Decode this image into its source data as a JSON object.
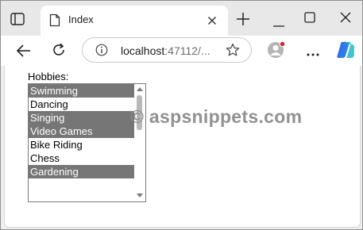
{
  "browser": {
    "tab": {
      "title": "Index",
      "favicon": "page-icon"
    },
    "address": {
      "host": "localhost",
      "rest": ":47112/..."
    },
    "icons": [
      "tab-actions-icon",
      "close-icon",
      "plus-icon",
      "minimize-icon",
      "maximize-icon",
      "close-icon",
      "back-arrow-icon",
      "refresh-icon",
      "info-icon",
      "star-icon",
      "profile-icon",
      "more-icon",
      "copilot-icon"
    ],
    "colors": {
      "tabstrip": "#e8e8e8",
      "notification_dot": "#d8202a"
    }
  },
  "form": {
    "label": "Hobbies:",
    "options": [
      {
        "text": "Swimming",
        "selected": true
      },
      {
        "text": "Dancing",
        "selected": false
      },
      {
        "text": "Singing",
        "selected": true
      },
      {
        "text": "Video Games",
        "selected": true
      },
      {
        "text": "Bike Riding",
        "selected": false
      },
      {
        "text": "Chess",
        "selected": false
      },
      {
        "text": "Gardening",
        "selected": true
      }
    ],
    "selected_color": "#767676"
  },
  "watermark": "© aspsnippets.com"
}
